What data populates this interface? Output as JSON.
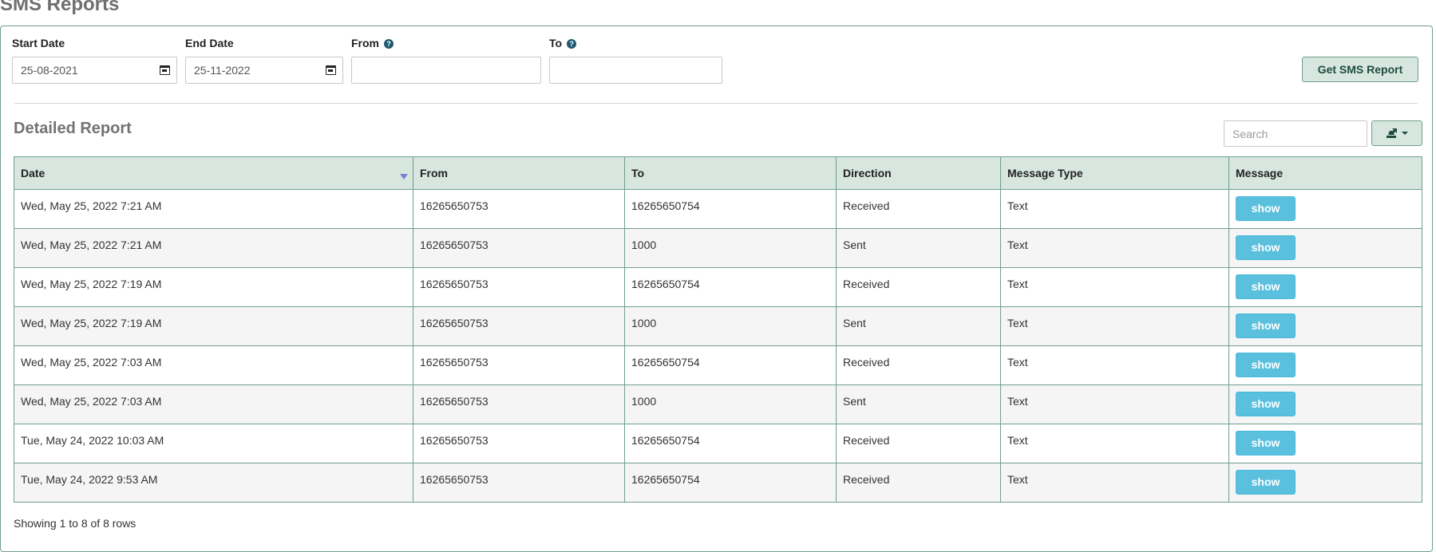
{
  "page": {
    "title": "SMS Reports"
  },
  "filters": {
    "start_date": {
      "label": "Start Date",
      "value": "25-08-2021"
    },
    "end_date": {
      "label": "End Date",
      "value": "25-11-2022"
    },
    "from": {
      "label": "From",
      "value": ""
    },
    "to": {
      "label": "To",
      "value": ""
    },
    "help_glyph": "?",
    "submit_label": "Get SMS Report"
  },
  "report": {
    "title": "Detailed Report",
    "search_placeholder": "Search",
    "columns": [
      "Date",
      "From",
      "To",
      "Direction",
      "Message Type",
      "Message"
    ],
    "show_label": "show",
    "rows": [
      [
        "Wed, May 25, 2022 7:21 AM",
        "16265650753",
        "16265650754",
        "Received",
        "Text"
      ],
      [
        "Wed, May 25, 2022 7:21 AM",
        "16265650753",
        "1000",
        "Sent",
        "Text"
      ],
      [
        "Wed, May 25, 2022 7:19 AM",
        "16265650753",
        "16265650754",
        "Received",
        "Text"
      ],
      [
        "Wed, May 25, 2022 7:19 AM",
        "16265650753",
        "1000",
        "Sent",
        "Text"
      ],
      [
        "Wed, May 25, 2022 7:03 AM",
        "16265650753",
        "16265650754",
        "Received",
        "Text"
      ],
      [
        "Wed, May 25, 2022 7:03 AM",
        "16265650753",
        "1000",
        "Sent",
        "Text"
      ],
      [
        "Tue, May 24, 2022 10:03 AM",
        "16265650753",
        "16265650754",
        "Received",
        "Text"
      ],
      [
        "Tue, May 24, 2022 9:53 AM",
        "16265650753",
        "16265650754",
        "Received",
        "Text"
      ]
    ],
    "footer": "Showing 1 to 8 of 8 rows"
  },
  "colors": {
    "accent_border": "#6f9f8d",
    "header_bg": "#d7e6df",
    "show_button": "#5bc0de",
    "sort_icon": "#7a7fd0"
  },
  "icons": {
    "help": "help-icon",
    "calendar": "calendar-icon",
    "sort": "sort-desc-icon",
    "export": "export-icon",
    "caret": "caret-down-icon"
  }
}
